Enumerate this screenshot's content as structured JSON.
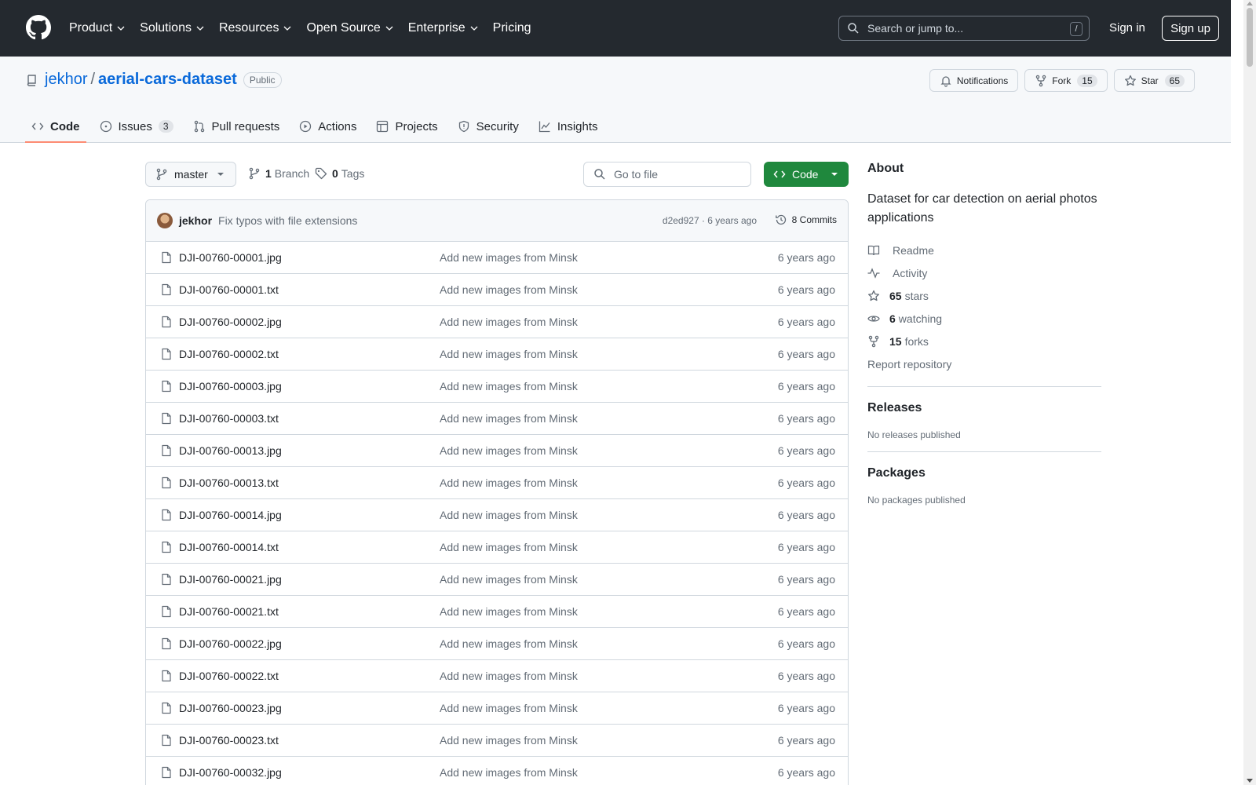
{
  "header": {
    "nav": [
      {
        "label": "Product",
        "has_caret": true
      },
      {
        "label": "Solutions",
        "has_caret": true
      },
      {
        "label": "Resources",
        "has_caret": true
      },
      {
        "label": "Open Source",
        "has_caret": true
      },
      {
        "label": "Enterprise",
        "has_caret": true
      },
      {
        "label": "Pricing",
        "has_caret": false
      }
    ],
    "search_placeholder": "Search or jump to...",
    "search_shortcut": "/",
    "sign_in": "Sign in",
    "sign_up": "Sign up"
  },
  "repo": {
    "owner": "jekhor",
    "separator": "/",
    "name": "aerial-cars-dataset",
    "visibility": "Public",
    "notifications_label": "Notifications",
    "fork_label": "Fork",
    "fork_count": "15",
    "star_label": "Star",
    "star_count": "65"
  },
  "tabs": [
    {
      "label": "Code",
      "icon": "code-icon",
      "count": ""
    },
    {
      "label": "Issues",
      "icon": "issue-icon",
      "count": "3"
    },
    {
      "label": "Pull requests",
      "icon": "pull-request-icon",
      "count": ""
    },
    {
      "label": "Actions",
      "icon": "play-icon",
      "count": ""
    },
    {
      "label": "Projects",
      "icon": "table-icon",
      "count": ""
    },
    {
      "label": "Security",
      "icon": "shield-icon",
      "count": ""
    },
    {
      "label": "Insights",
      "icon": "graph-icon",
      "count": ""
    }
  ],
  "toolbar": {
    "branch": "master",
    "branches_count": "1",
    "branches_label": "Branch",
    "tags_count": "0",
    "tags_label": "Tags",
    "goto_placeholder": "Go to file",
    "code_label": "Code"
  },
  "commit": {
    "author": "jekhor",
    "message": "Fix typos with file extensions",
    "meta": "d2ed927 · 6 years ago",
    "count_label": "8 Commits"
  },
  "files": [
    {
      "name": "DJI-00760-00001.jpg",
      "message": "Add new images from Minsk",
      "age": "6 years ago"
    },
    {
      "name": "DJI-00760-00001.txt",
      "message": "Add new images from Minsk",
      "age": "6 years ago"
    },
    {
      "name": "DJI-00760-00002.jpg",
      "message": "Add new images from Minsk",
      "age": "6 years ago"
    },
    {
      "name": "DJI-00760-00002.txt",
      "message": "Add new images from Minsk",
      "age": "6 years ago"
    },
    {
      "name": "DJI-00760-00003.jpg",
      "message": "Add new images from Minsk",
      "age": "6 years ago"
    },
    {
      "name": "DJI-00760-00003.txt",
      "message": "Add new images from Minsk",
      "age": "6 years ago"
    },
    {
      "name": "DJI-00760-00013.jpg",
      "message": "Add new images from Minsk",
      "age": "6 years ago"
    },
    {
      "name": "DJI-00760-00013.txt",
      "message": "Add new images from Minsk",
      "age": "6 years ago"
    },
    {
      "name": "DJI-00760-00014.jpg",
      "message": "Add new images from Minsk",
      "age": "6 years ago"
    },
    {
      "name": "DJI-00760-00014.txt",
      "message": "Add new images from Minsk",
      "age": "6 years ago"
    },
    {
      "name": "DJI-00760-00021.jpg",
      "message": "Add new images from Minsk",
      "age": "6 years ago"
    },
    {
      "name": "DJI-00760-00021.txt",
      "message": "Add new images from Minsk",
      "age": "6 years ago"
    },
    {
      "name": "DJI-00760-00022.jpg",
      "message": "Add new images from Minsk",
      "age": "6 years ago"
    },
    {
      "name": "DJI-00760-00022.txt",
      "message": "Add new images from Minsk",
      "age": "6 years ago"
    },
    {
      "name": "DJI-00760-00023.jpg",
      "message": "Add new images from Minsk",
      "age": "6 years ago"
    },
    {
      "name": "DJI-00760-00023.txt",
      "message": "Add new images from Minsk",
      "age": "6 years ago"
    },
    {
      "name": "DJI-00760-00032.jpg",
      "message": "Add new images from Minsk",
      "age": "6 years ago"
    }
  ],
  "about": {
    "title": "About",
    "description": "Dataset for car detection on aerial photos applications",
    "links": [
      {
        "icon": "book-icon",
        "bold": "",
        "label": "Readme"
      },
      {
        "icon": "pulse-icon",
        "bold": "",
        "label": "Activity"
      },
      {
        "icon": "star-icon",
        "bold": "65",
        "label": "stars"
      },
      {
        "icon": "eye-icon",
        "bold": "6",
        "label": "watching"
      },
      {
        "icon": "fork-icon",
        "bold": "15",
        "label": "forks"
      }
    ],
    "report": "Report repository"
  },
  "releases": {
    "title": "Releases",
    "empty": "No releases published"
  },
  "packages": {
    "title": "Packages",
    "empty": "No packages published"
  },
  "colors": {
    "header_bg": "#24292f",
    "link": "#0969da",
    "primary_button": "#1f883d",
    "active_tab": "#fd8c73"
  }
}
